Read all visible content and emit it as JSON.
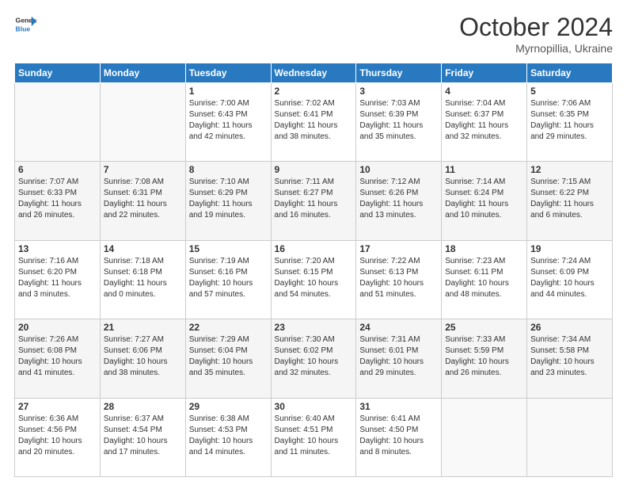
{
  "logo": {
    "line1": "General",
    "line2": "Blue"
  },
  "title": "October 2024",
  "subtitle": "Myrnopillia, Ukraine",
  "days_of_week": [
    "Sunday",
    "Monday",
    "Tuesday",
    "Wednesday",
    "Thursday",
    "Friday",
    "Saturday"
  ],
  "weeks": [
    [
      null,
      null,
      {
        "day": "1",
        "sunrise": "7:00 AM",
        "sunset": "6:43 PM",
        "daylight": "11 hours and 42 minutes."
      },
      {
        "day": "2",
        "sunrise": "7:02 AM",
        "sunset": "6:41 PM",
        "daylight": "11 hours and 38 minutes."
      },
      {
        "day": "3",
        "sunrise": "7:03 AM",
        "sunset": "6:39 PM",
        "daylight": "11 hours and 35 minutes."
      },
      {
        "day": "4",
        "sunrise": "7:04 AM",
        "sunset": "6:37 PM",
        "daylight": "11 hours and 32 minutes."
      },
      {
        "day": "5",
        "sunrise": "7:06 AM",
        "sunset": "6:35 PM",
        "daylight": "11 hours and 29 minutes."
      }
    ],
    [
      {
        "day": "6",
        "sunrise": "7:07 AM",
        "sunset": "6:33 PM",
        "daylight": "11 hours and 26 minutes."
      },
      {
        "day": "7",
        "sunrise": "7:08 AM",
        "sunset": "6:31 PM",
        "daylight": "11 hours and 22 minutes."
      },
      {
        "day": "8",
        "sunrise": "7:10 AM",
        "sunset": "6:29 PM",
        "daylight": "11 hours and 19 minutes."
      },
      {
        "day": "9",
        "sunrise": "7:11 AM",
        "sunset": "6:27 PM",
        "daylight": "11 hours and 16 minutes."
      },
      {
        "day": "10",
        "sunrise": "7:12 AM",
        "sunset": "6:26 PM",
        "daylight": "11 hours and 13 minutes."
      },
      {
        "day": "11",
        "sunrise": "7:14 AM",
        "sunset": "6:24 PM",
        "daylight": "11 hours and 10 minutes."
      },
      {
        "day": "12",
        "sunrise": "7:15 AM",
        "sunset": "6:22 PM",
        "daylight": "11 hours and 6 minutes."
      }
    ],
    [
      {
        "day": "13",
        "sunrise": "7:16 AM",
        "sunset": "6:20 PM",
        "daylight": "11 hours and 3 minutes."
      },
      {
        "day": "14",
        "sunrise": "7:18 AM",
        "sunset": "6:18 PM",
        "daylight": "11 hours and 0 minutes."
      },
      {
        "day": "15",
        "sunrise": "7:19 AM",
        "sunset": "6:16 PM",
        "daylight": "10 hours and 57 minutes."
      },
      {
        "day": "16",
        "sunrise": "7:20 AM",
        "sunset": "6:15 PM",
        "daylight": "10 hours and 54 minutes."
      },
      {
        "day": "17",
        "sunrise": "7:22 AM",
        "sunset": "6:13 PM",
        "daylight": "10 hours and 51 minutes."
      },
      {
        "day": "18",
        "sunrise": "7:23 AM",
        "sunset": "6:11 PM",
        "daylight": "10 hours and 48 minutes."
      },
      {
        "day": "19",
        "sunrise": "7:24 AM",
        "sunset": "6:09 PM",
        "daylight": "10 hours and 44 minutes."
      }
    ],
    [
      {
        "day": "20",
        "sunrise": "7:26 AM",
        "sunset": "6:08 PM",
        "daylight": "10 hours and 41 minutes."
      },
      {
        "day": "21",
        "sunrise": "7:27 AM",
        "sunset": "6:06 PM",
        "daylight": "10 hours and 38 minutes."
      },
      {
        "day": "22",
        "sunrise": "7:29 AM",
        "sunset": "6:04 PM",
        "daylight": "10 hours and 35 minutes."
      },
      {
        "day": "23",
        "sunrise": "7:30 AM",
        "sunset": "6:02 PM",
        "daylight": "10 hours and 32 minutes."
      },
      {
        "day": "24",
        "sunrise": "7:31 AM",
        "sunset": "6:01 PM",
        "daylight": "10 hours and 29 minutes."
      },
      {
        "day": "25",
        "sunrise": "7:33 AM",
        "sunset": "5:59 PM",
        "daylight": "10 hours and 26 minutes."
      },
      {
        "day": "26",
        "sunrise": "7:34 AM",
        "sunset": "5:58 PM",
        "daylight": "10 hours and 23 minutes."
      }
    ],
    [
      {
        "day": "27",
        "sunrise": "6:36 AM",
        "sunset": "4:56 PM",
        "daylight": "10 hours and 20 minutes."
      },
      {
        "day": "28",
        "sunrise": "6:37 AM",
        "sunset": "4:54 PM",
        "daylight": "10 hours and 17 minutes."
      },
      {
        "day": "29",
        "sunrise": "6:38 AM",
        "sunset": "4:53 PM",
        "daylight": "10 hours and 14 minutes."
      },
      {
        "day": "30",
        "sunrise": "6:40 AM",
        "sunset": "4:51 PM",
        "daylight": "10 hours and 11 minutes."
      },
      {
        "day": "31",
        "sunrise": "6:41 AM",
        "sunset": "4:50 PM",
        "daylight": "10 hours and 8 minutes."
      },
      null,
      null
    ]
  ],
  "labels": {
    "sunrise_prefix": "Sunrise: ",
    "sunset_prefix": "Sunset: ",
    "daylight_prefix": "Daylight: "
  }
}
